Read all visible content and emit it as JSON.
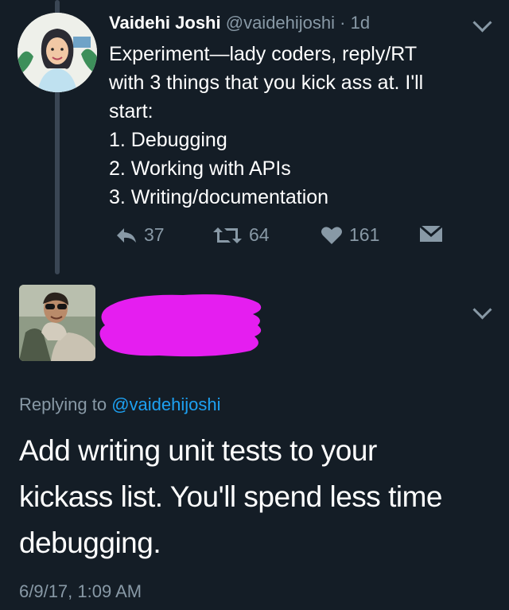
{
  "tweet1": {
    "name": "Vaidehi Joshi",
    "handle": "@vaidehijoshi",
    "time": "· 1d",
    "body_lines": [
      "Experiment—lady coders, reply/RT",
      "with 3 things that you kick ass at. I'll",
      "start:",
      "1. Debugging",
      "2. Working with APIs",
      "3. Writing/documentation"
    ],
    "actions": {
      "reply_count": "37",
      "retweet_count": "64",
      "like_count": "161"
    }
  },
  "tweet2": {
    "replying_prefix": "Replying to",
    "replying_handle": "@vaidehijoshi",
    "body_lines": [
      "Add writing unit tests to your",
      "kickass list. You'll spend less time",
      "debugging."
    ],
    "timestamp": "6/9/17, 1:09 AM"
  },
  "colors": {
    "background": "#141d26",
    "secondary_text": "#8899a6",
    "link": "#1da1f2",
    "redaction": "#e51ef0"
  },
  "icons": [
    "reply-icon",
    "retweet-icon",
    "like-icon",
    "dm-icon",
    "chevron-down-icon"
  ]
}
